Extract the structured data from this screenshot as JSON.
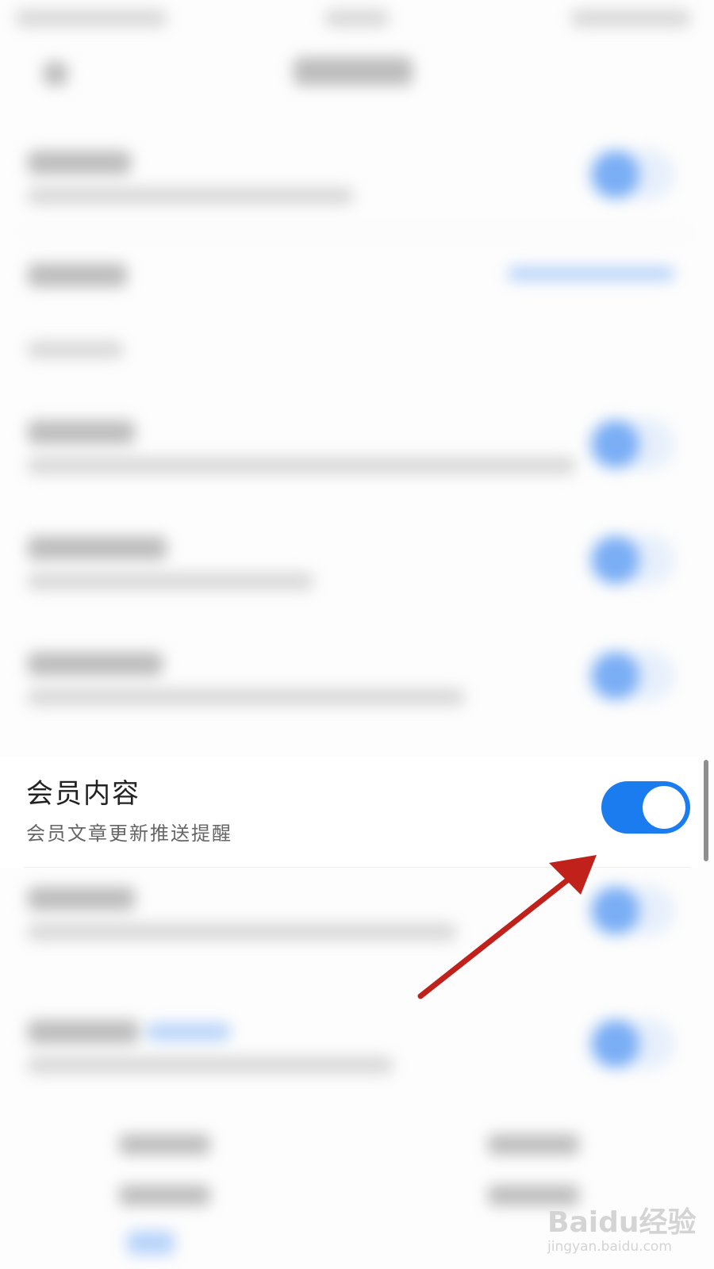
{
  "setting_row": {
    "title": "会员内容",
    "subtitle": "会员文章更新推送提醒",
    "toggle_on": true
  },
  "colors": {
    "toggle_on": "#1b7cf0",
    "arrow": "#c0211a"
  },
  "watermark": {
    "logo": "Baidu经验",
    "url": "jingyan.baidu.com"
  }
}
